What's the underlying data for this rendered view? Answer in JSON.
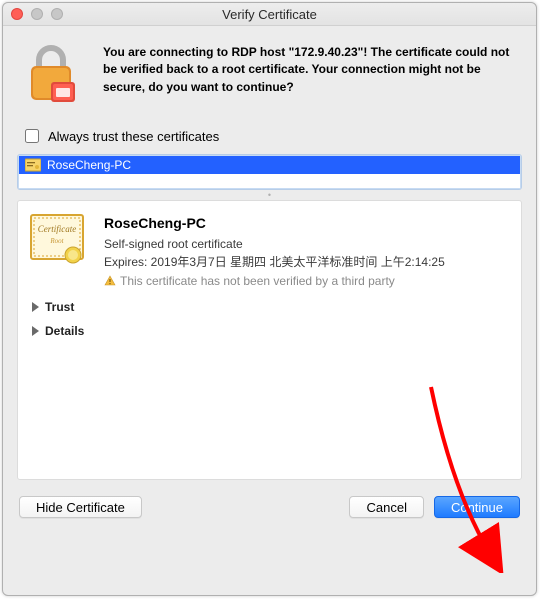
{
  "window": {
    "title": "Verify Certificate"
  },
  "message": "You are connecting to RDP host \"172.9.40.23\"! The certificate could not be verified back to a root certificate. Your connection might not be secure, do you want to continue?",
  "always_trust": {
    "label": "Always trust these certificates",
    "checked": false
  },
  "cert_list": {
    "items": [
      {
        "label": "RoseCheng-PC"
      }
    ]
  },
  "cert_detail": {
    "name": "RoseCheng-PC",
    "subtitle": "Self-signed root certificate",
    "expires_label": "Expires: 2019年3月7日 星期四 北美太平洋标准时间 上午2:14:25",
    "warning": "This certificate has not been verified by a third party"
  },
  "disclosures": {
    "trust": "Trust",
    "details": "Details"
  },
  "buttons": {
    "hide_certificate": "Hide Certificate",
    "cancel": "Cancel",
    "continue": "Continue"
  }
}
